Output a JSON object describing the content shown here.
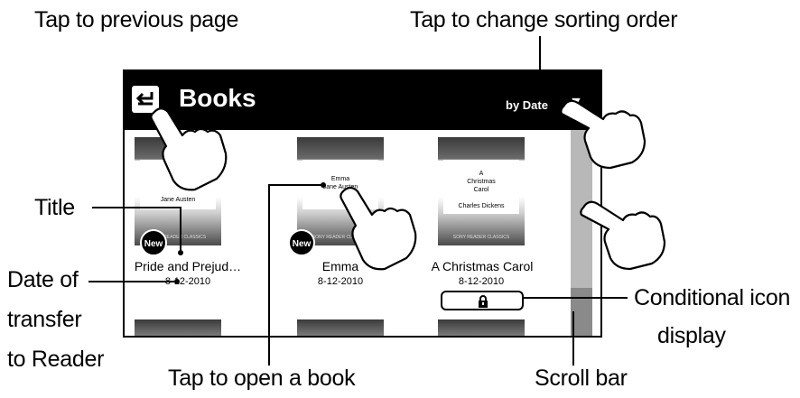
{
  "callouts": {
    "previous_page": "Tap to previous page",
    "sorting_order": "Tap to change sorting order",
    "title": "Title",
    "date_line1": "Date of",
    "date_line2": "transfer",
    "date_line3": "to Reader",
    "open_book": "Tap to open a book",
    "conditional_line1": "Conditional icon",
    "conditional_line2": "display",
    "scroll_bar": "Scroll bar"
  },
  "screen": {
    "title": "Books",
    "sort_label": "by Date",
    "sort_arrow": "▼",
    "back_icon": "back-arrow-icon",
    "books": [
      {
        "title": "Pride and Prejud…",
        "date": "8-12-2010",
        "badge": "New",
        "cover_text": "Jane Austen",
        "cover_footer": "SONY READER CLASSICS"
      },
      {
        "title": "Emma",
        "date": "8-12-2010",
        "badge": "New",
        "cover_text": "Emma\nJane Austen",
        "cover_footer": "SONY READER CLASSICS"
      },
      {
        "title": "A Christmas Carol",
        "date": "8-12-2010",
        "badge": "",
        "cover_text": "A\nChristmas\nCarol\n\nCharles Dickens",
        "cover_footer": "SONY READER CLASSICS"
      }
    ],
    "lock_icon": "lock-icon",
    "hand_icon": "pointing-hand-icon"
  },
  "colors": {
    "header_bg": "#000000",
    "scroll_track": "#b8b8b8",
    "scroll_thumb": "#8a8a8a"
  }
}
